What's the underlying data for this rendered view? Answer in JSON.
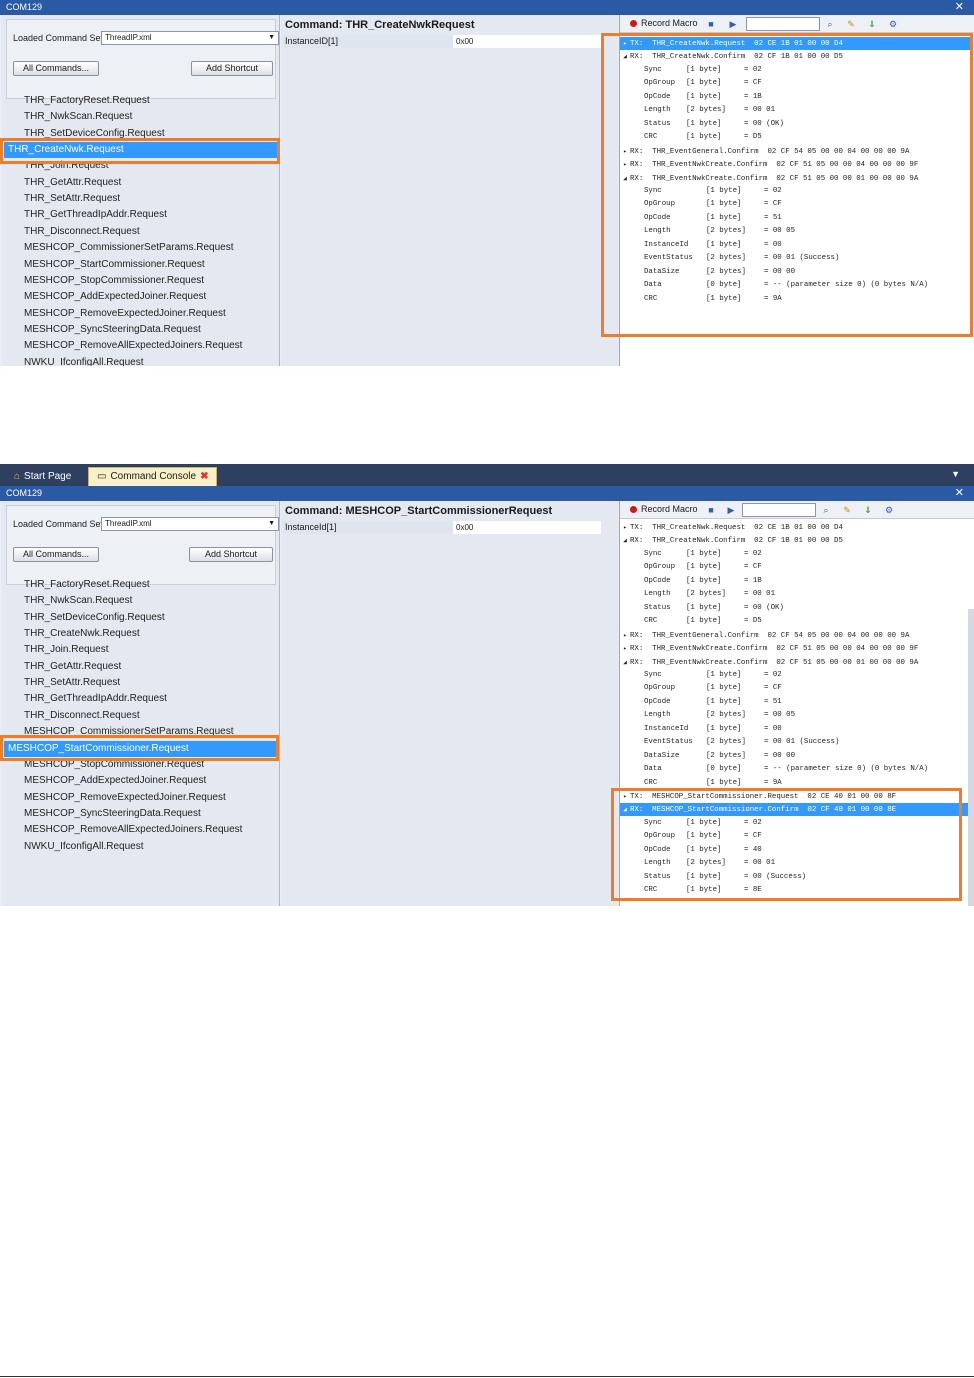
{
  "shot1": {
    "window_title": "COM129",
    "loaded_command_set_label": "Loaded Command Set",
    "command_set_value": "ThreadIP.xml",
    "all_commands_label": "All Commands...",
    "add_shortcut_label": "Add Shortcut",
    "command_title": "Command: THR_CreateNwkRequest",
    "param_label": "InstanceID[1]",
    "param_value": "0x00",
    "record_macro_label": "Record Macro",
    "commands": [
      "THR_FactoryReset.Request",
      "THR_NwkScan.Request",
      "THR_SetDeviceConfig.Request",
      "THR_CreateNwk.Request",
      "THR_Join.Request",
      "THR_GetAttr.Request",
      "THR_SetAttr.Request",
      "THR_GetThreadIpAddr.Request",
      "THR_Disconnect.Request",
      "MESHCOP_CommissionerSetParams.Request",
      "MESHCOP_StartCommissioner.Request",
      "MESHCOP_StopCommissioner.Request",
      "MESHCOP_AddExpectedJoiner.Request",
      "MESHCOP_RemoveExpectedJoiner.Request",
      "MESHCOP_SyncSteeringData.Request",
      "MESHCOP_RemoveAllExpectedJoiners.Request",
      "NWKU_IfconfigAll.Request"
    ],
    "selected_command_index": 3,
    "log": [
      {
        "kind": "header",
        "tri": "▸",
        "text": "TX:  THR_CreateNwk.Request  02 CE 1B 01 00 00 D4",
        "selected": true
      },
      {
        "kind": "header",
        "tri": "◢",
        "text": "RX:  THR_CreateNwk.Confirm  02 CF 1B 01 00 00 D5",
        "selected": false
      },
      {
        "kind": "field",
        "name": "Sync",
        "size": "[1 byte]",
        "value": "= 02"
      },
      {
        "kind": "field",
        "name": "OpGroup",
        "size": "[1 byte]",
        "value": "= CF"
      },
      {
        "kind": "field",
        "name": "OpCode",
        "size": "[1 byte]",
        "value": "= 1B"
      },
      {
        "kind": "field",
        "name": "Length",
        "size": "[2 bytes]",
        "value": "= 00 01"
      },
      {
        "kind": "field",
        "name": "Status",
        "size": "[1 byte]",
        "value": "= 00 (OK)"
      },
      {
        "kind": "field",
        "name": "CRC",
        "size": "[1 byte]",
        "value": "= D5"
      },
      {
        "kind": "header",
        "tri": "▸",
        "text": "RX:  THR_EventGeneral.Confirm  02 CF 54 05 00 00 04 00 00 00 9A",
        "selected": false
      },
      {
        "kind": "header",
        "tri": "▸",
        "text": "RX:  THR_EventNwkCreate.Confirm  02 CF 51 05 00 00 04 00 00 00 9F",
        "selected": false
      },
      {
        "kind": "header",
        "tri": "◢",
        "text": "RX:  THR_EventNwkCreate.Confirm  02 CF 51 05 00 00 01 00 00 00 9A",
        "selected": false
      },
      {
        "kind": "field2",
        "name": "Sync",
        "size": "[1 byte]",
        "value": "= 02"
      },
      {
        "kind": "field2",
        "name": "OpGroup",
        "size": "[1 byte]",
        "value": "= CF"
      },
      {
        "kind": "field2",
        "name": "OpCode",
        "size": "[1 byte]",
        "value": "= 51"
      },
      {
        "kind": "field2",
        "name": "Length",
        "size": "[2 bytes]",
        "value": "= 00 05"
      },
      {
        "kind": "field2",
        "name": "InstanceId",
        "size": "[1 byte]",
        "value": "= 00"
      },
      {
        "kind": "field2",
        "name": "EventStatus",
        "size": "[2 bytes]",
        "value": "= 00 01 (Success)"
      },
      {
        "kind": "field2",
        "name": "DataSize",
        "size": "[2 bytes]",
        "value": "= 00 00"
      },
      {
        "kind": "field2",
        "name": "Data",
        "size": "[0 byte]",
        "value": "= -- (parameter size 0) (0 bytes N/A)"
      },
      {
        "kind": "field2",
        "name": "CRC",
        "size": "[1 byte]",
        "value": "= 9A"
      }
    ]
  },
  "shot2": {
    "tabs": [
      {
        "label": "Start Page",
        "active": false
      },
      {
        "label": "Command Console",
        "active": true
      }
    ],
    "window_title": "COM129",
    "loaded_command_set_label": "Loaded Command Set",
    "command_set_value": "ThreadIP.xml",
    "all_commands_label": "All Commands...",
    "add_shortcut_label": "Add Shortcut",
    "command_title": "Command: MESHCOP_StartCommissionerRequest",
    "param_label": "InstanceId[1]",
    "param_value": "0x00",
    "record_macro_label": "Record Macro",
    "commands": [
      "THR_FactoryReset.Request",
      "THR_NwkScan.Request",
      "THR_SetDeviceConfig.Request",
      "THR_CreateNwk.Request",
      "THR_Join.Request",
      "THR_GetAttr.Request",
      "THR_SetAttr.Request",
      "THR_GetThreadIpAddr.Request",
      "THR_Disconnect.Request",
      "MESHCOP_CommissionerSetParams.Request",
      "MESHCOP_StartCommissioner.Request",
      "MESHCOP_StopCommissioner.Request",
      "MESHCOP_AddExpectedJoiner.Request",
      "MESHCOP_RemoveExpectedJoiner.Request",
      "MESHCOP_SyncSteeringData.Request",
      "MESHCOP_RemoveAllExpectedJoiners.Request",
      "NWKU_IfconfigAll.Request"
    ],
    "selected_command_index": 10,
    "log": [
      {
        "kind": "header",
        "tri": "▸",
        "text": "TX:  THR_CreateNwk.Request  02 CE 1B 01 00 00 D4",
        "selected": false
      },
      {
        "kind": "header",
        "tri": "◢",
        "text": "RX:  THR_CreateNwk.Confirm  02 CF 1B 01 00 00 D5",
        "selected": false
      },
      {
        "kind": "field",
        "name": "Sync",
        "size": "[1 byte]",
        "value": "= 02"
      },
      {
        "kind": "field",
        "name": "OpGroup",
        "size": "[1 byte]",
        "value": "= CF"
      },
      {
        "kind": "field",
        "name": "OpCode",
        "size": "[1 byte]",
        "value": "= 1B"
      },
      {
        "kind": "field",
        "name": "Length",
        "size": "[2 bytes]",
        "value": "= 00 01"
      },
      {
        "kind": "field",
        "name": "Status",
        "size": "[1 byte]",
        "value": "= 00 (OK)"
      },
      {
        "kind": "field",
        "name": "CRC",
        "size": "[1 byte]",
        "value": "= D5"
      },
      {
        "kind": "header",
        "tri": "▸",
        "text": "RX:  THR_EventGeneral.Confirm  02 CF 54 05 00 00 04 00 00 00 9A",
        "selected": false
      },
      {
        "kind": "header",
        "tri": "▸",
        "text": "RX:  THR_EventNwkCreate.Confirm  02 CF 51 05 00 00 04 00 00 00 9F",
        "selected": false
      },
      {
        "kind": "header",
        "tri": "◢",
        "text": "RX:  THR_EventNwkCreate.Confirm  02 CF 51 05 00 00 01 00 00 00 9A",
        "selected": false
      },
      {
        "kind": "field2",
        "name": "Sync",
        "size": "[1 byte]",
        "value": "= 02"
      },
      {
        "kind": "field2",
        "name": "OpGroup",
        "size": "[1 byte]",
        "value": "= CF"
      },
      {
        "kind": "field2",
        "name": "OpCode",
        "size": "[1 byte]",
        "value": "= 51"
      },
      {
        "kind": "field2",
        "name": "Length",
        "size": "[2 bytes]",
        "value": "= 00 05"
      },
      {
        "kind": "field2",
        "name": "InstanceId",
        "size": "[1 byte]",
        "value": "= 00"
      },
      {
        "kind": "field2",
        "name": "EventStatus",
        "size": "[2 bytes]",
        "value": "= 00 01 (Success)"
      },
      {
        "kind": "field2",
        "name": "DataSize",
        "size": "[2 bytes]",
        "value": "= 00 00"
      },
      {
        "kind": "field2",
        "name": "Data",
        "size": "[0 byte]",
        "value": "= -- (parameter size 0) (0 bytes N/A)"
      },
      {
        "kind": "field2",
        "name": "CRC",
        "size": "[1 byte]",
        "value": "= 9A"
      },
      {
        "kind": "header",
        "tri": "▸",
        "text": "TX:  MESHCOP_StartCommissioner.Request  02 CE 40 01 00 00 8F",
        "selected": false
      },
      {
        "kind": "header",
        "tri": "◢",
        "text": "RX:  MESHCOP_StartCommissioner.Confirm  02 CF 40 01 00 00 8E",
        "selected": true
      },
      {
        "kind": "field",
        "name": "Sync",
        "size": "[1 byte]",
        "value": "= 02"
      },
      {
        "kind": "field",
        "name": "OpGroup",
        "size": "[1 byte]",
        "value": "= CF"
      },
      {
        "kind": "field",
        "name": "OpCode",
        "size": "[1 byte]",
        "value": "= 40"
      },
      {
        "kind": "field",
        "name": "Length",
        "size": "[2 bytes]",
        "value": "= 00 01"
      },
      {
        "kind": "field",
        "name": "Status",
        "size": "[1 byte]",
        "value": "= 00 (Success)"
      },
      {
        "kind": "field",
        "name": "CRC",
        "size": "[1 byte]",
        "value": "= 8E"
      }
    ]
  },
  "colors": {
    "highlight": "#ef7d28",
    "selection": "#3399ff",
    "titlebar": "#2b5aa5",
    "panel": "#e4e9f1"
  }
}
